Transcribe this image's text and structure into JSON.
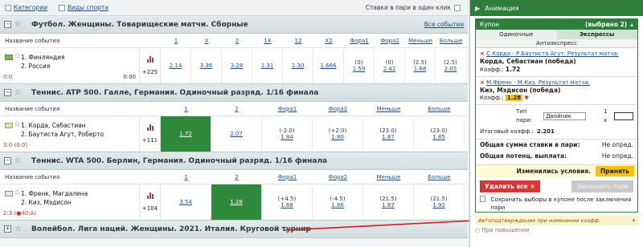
{
  "topbar": {
    "categories": "Категории",
    "sports_type": "Виды спорта",
    "one_click": "Ставки в пари в один клик"
  },
  "football": {
    "title": "Футбол. Женщины. Товарищеские матчи. Сборные",
    "all_events": "Все события",
    "headers": [
      "Название события",
      "1",
      "X",
      "2",
      "1X",
      "12",
      "X2",
      "Фора1",
      "Фора2",
      "Меньше",
      "Больше"
    ],
    "team1": "1. Финляндия",
    "team2": "2. Россия",
    "score": "0:0",
    "time": "0:00",
    "more": "+225",
    "odds": [
      {
        "v": "2.14"
      },
      {
        "v": "3.36"
      },
      {
        "v": "3.28"
      },
      {
        "v": "1.31"
      },
      {
        "v": "1.30"
      },
      {
        "v": "1.666"
      },
      {
        "s": "(0)",
        "v": "1.59"
      },
      {
        "s": "(0)",
        "v": "2.42"
      },
      {
        "s": "(2.5)",
        "v": "1.68"
      },
      {
        "s": "(2.5)",
        "v": "2.05"
      }
    ]
  },
  "tennis1": {
    "title": "Теннис. ATP 500. Галле, Германия. Одиночный разряд. 1/16 финала",
    "headers": [
      "Название события",
      "1",
      "2",
      "Фора1",
      "Фора2",
      "Меньше",
      "Больше"
    ],
    "team1": "1. Корда, Себастиан",
    "team2": "2. Баутиста Агут, Роберто",
    "score": "3:0 (0:0)",
    "more": "+111",
    "odds": [
      {
        "v": "1.72"
      },
      {
        "v": "2.07"
      },
      {
        "s": "(-2.0)",
        "v": "1.84"
      },
      {
        "s": "(+2.0)",
        "v": "1.80"
      },
      {
        "s": "(23.0)",
        "v": "1.87"
      },
      {
        "s": "(23.0)",
        "v": "1.85"
      }
    ]
  },
  "tennis2": {
    "title": "Теннис. WTA 500. Берлин, Германия. Одиночный разряд. 1/16 финала",
    "headers": [
      "Название события",
      "1",
      "2",
      "Фора1",
      "Фора2",
      "Меньше",
      "Больше"
    ],
    "team1": "1. Френк, Магдалена",
    "team2": "2. Киз, Мэдисон",
    "score": "2:3 (●40:A)",
    "more": "+104",
    "odds": [
      {
        "v": "3.54"
      },
      {
        "v": "1.28"
      },
      {
        "s": "(+4.5)",
        "v": "1.88"
      },
      {
        "s": "(-4.5)",
        "v": "1.86"
      },
      {
        "s": "(21.5)",
        "v": "1.87"
      },
      {
        "s": "(21.5)",
        "v": "1.92"
      }
    ]
  },
  "volley": {
    "title": "Волейбол. Лига наций. Женщины. 2021. Италия. Круговой турнир"
  },
  "panel": {
    "animation": "Анимация",
    "coupon": "Купон",
    "selected": "(выбрано 2)",
    "tab_single": "Одиночные",
    "tab_express": "Экспрессы",
    "antiexpress": "Антиэкспресс",
    "bet1_match": "С.Корда - Р.Баутиста Агут. Результат матча:",
    "bet1_pick": "Корда, Себастиан (победа)",
    "bet1_coef_label": "Коэфф.:",
    "bet1_coef": "1.72",
    "bet2_match": "М.Френк - М.Киз. Результат матча:",
    "bet2_pick": "Киз, Мэдисон (победа)",
    "bet2_coef_label": "Коэфф.:",
    "bet2_coef": "1.28",
    "type_label": "Тип пари:",
    "type_value": "Двойник",
    "mult": "1 x",
    "total_coef_label": "Итоговый коэфф.:",
    "total_coef": "2.201",
    "stake_label": "Общая сумма ставки в пари:",
    "stake_value": "Не опред.",
    "payout_label": "Общая потенц. выплата:",
    "payout_value": "Не опред.",
    "changed": "Изменились условия.",
    "accept": "Принять",
    "delete_all": "Удалить все ×",
    "make_bet": "Заключить пари",
    "save_text": "Сохранить выборы в купоне после заключения пари",
    "auto_confirm": "Автоподтверждение при изменении коэфф.",
    "on_raise": "При повышении"
  },
  "colors": {
    "accent": "#2d7d3b",
    "highlight": "#2e8a3a",
    "accept": "#f4c20d",
    "delete": "#dd3333"
  }
}
